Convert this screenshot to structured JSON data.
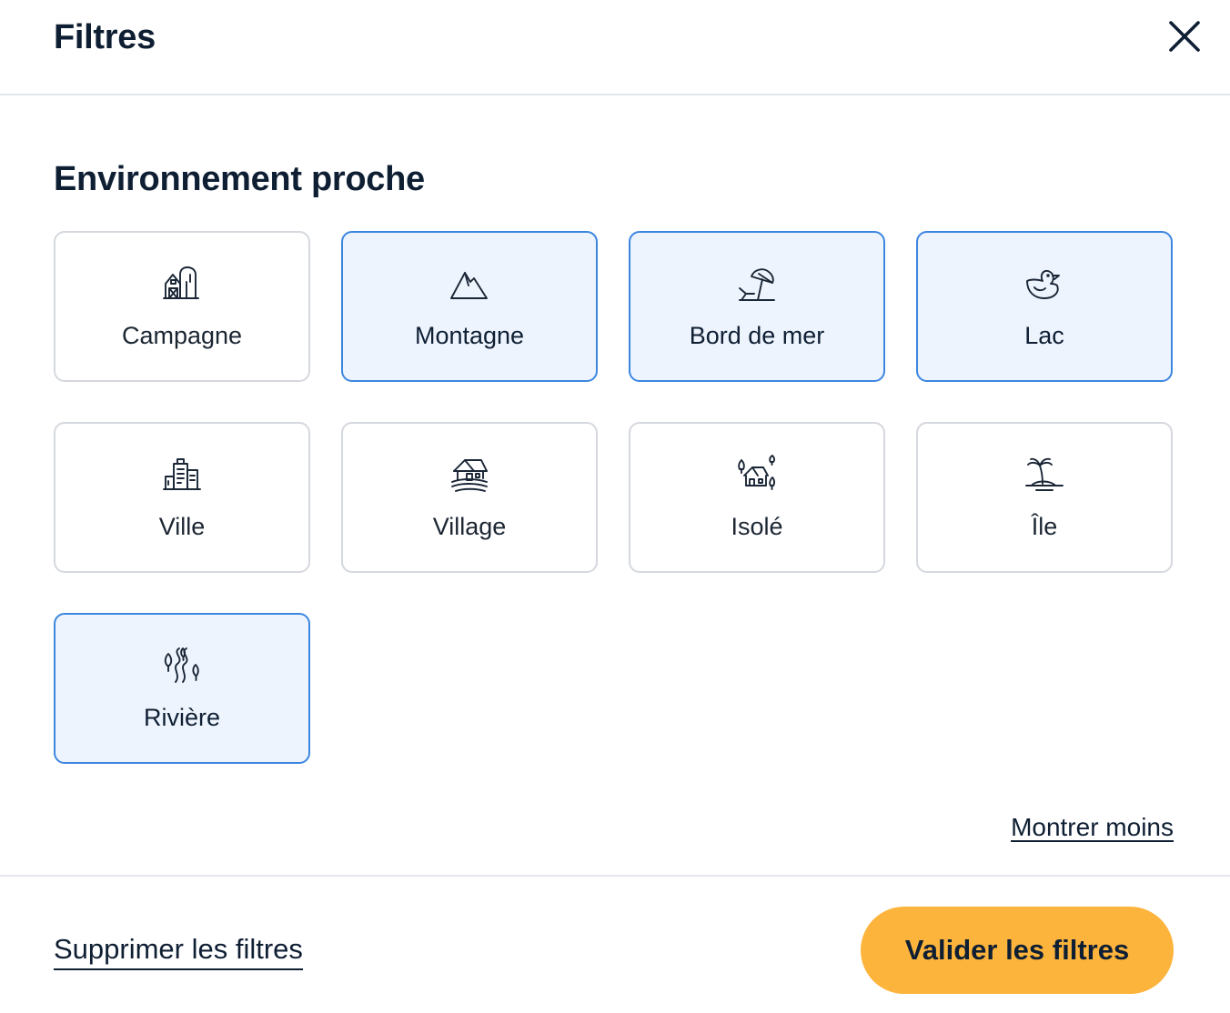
{
  "header": {
    "title": "Filtres",
    "close_icon": "close-icon"
  },
  "section": {
    "title": "Environnement proche",
    "options": [
      {
        "label": "Campagne",
        "icon": "barn-icon",
        "selected": false
      },
      {
        "label": "Montagne",
        "icon": "mountain-icon",
        "selected": true
      },
      {
        "label": "Bord de mer",
        "icon": "beach-umbrella-icon",
        "selected": true
      },
      {
        "label": "Lac",
        "icon": "duck-icon",
        "selected": true
      },
      {
        "label": "Ville",
        "icon": "city-buildings-icon",
        "selected": false
      },
      {
        "label": "Village",
        "icon": "village-house-icon",
        "selected": false
      },
      {
        "label": "Isolé",
        "icon": "isolated-house-icon",
        "selected": false
      },
      {
        "label": "Île",
        "icon": "island-palm-icon",
        "selected": false
      },
      {
        "label": "Rivière",
        "icon": "river-trees-icon",
        "selected": true
      }
    ],
    "show_less_label": "Montrer moins"
  },
  "footer": {
    "clear_label": "Supprimer les filtres",
    "apply_label": "Valider les filtres"
  },
  "colors": {
    "accent": "#fdb43c",
    "selected_border": "#3c86e0",
    "selected_background": "#edf4fe",
    "text": "#0f1f33"
  }
}
